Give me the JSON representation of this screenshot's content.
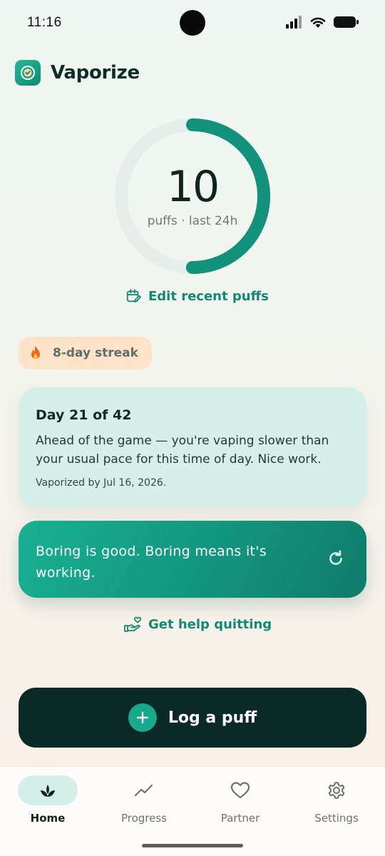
{
  "status_bar": {
    "time": "11:16"
  },
  "app": {
    "title": "Vaporize",
    "icon": "clock-check-icon",
    "accent": "#128a73"
  },
  "ring": {
    "count": "10",
    "caption": "puffs · last 24h",
    "fill_fraction": 0.5,
    "track_color": "#e6eeeb",
    "fill_color": "#12927a"
  },
  "edit_link": {
    "label": "Edit recent puffs",
    "icon": "calendar-edit-icon"
  },
  "streak": {
    "label": "8-day streak",
    "icon": "fire-icon"
  },
  "progress_card": {
    "title": "Day 21 of 42",
    "message": "Ahead of the game — you're vaping slower than your usual pace for this time of day. Nice work.",
    "footer": "Vaporized by Jul 16, 2026."
  },
  "quote_card": {
    "text": "Boring is good. Boring means it's working.",
    "icon": "refresh-icon"
  },
  "help_link": {
    "label": "Get help quitting",
    "icon": "hand-heart-icon"
  },
  "log_button": {
    "label": "Log a puff",
    "icon": "plus-icon"
  },
  "nav": {
    "items": [
      {
        "label": "Home",
        "icon": "sprout-icon",
        "active": true
      },
      {
        "label": "Progress",
        "icon": "trend-line-icon",
        "active": false
      },
      {
        "label": "Partner",
        "icon": "heart-icon",
        "active": false
      },
      {
        "label": "Settings",
        "icon": "gear-icon",
        "active": false
      }
    ]
  }
}
